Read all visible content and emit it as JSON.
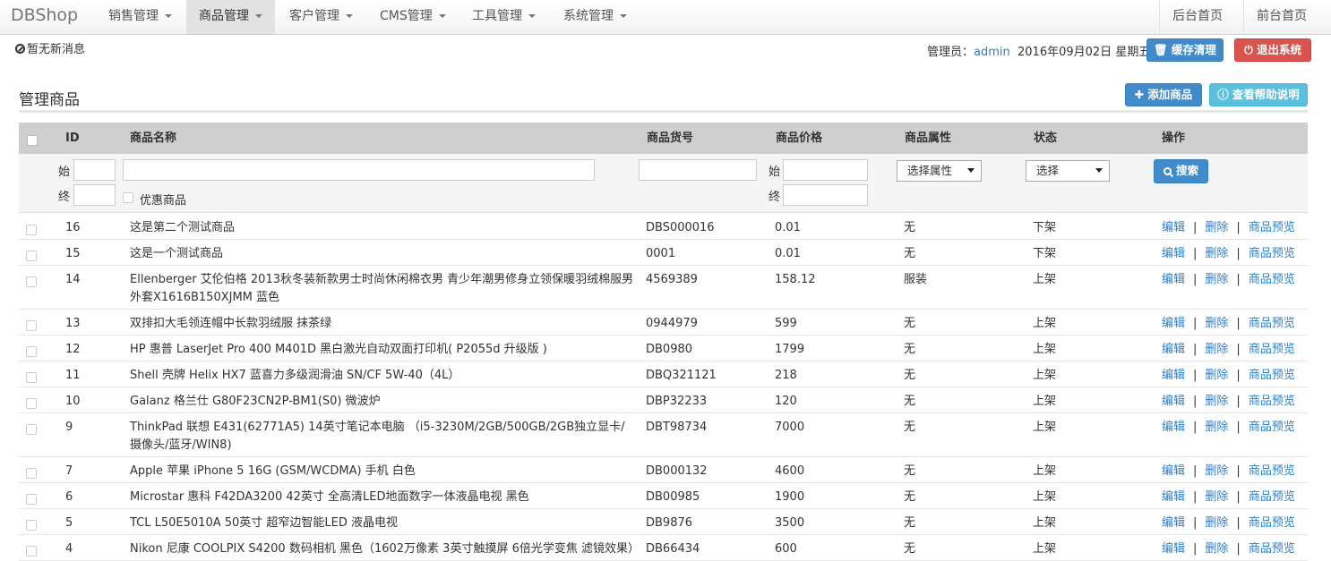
{
  "navbar": {
    "brand": "DBShop",
    "menus": [
      {
        "label": "销售管理",
        "active": false
      },
      {
        "label": "商品管理",
        "active": true
      },
      {
        "label": "客户管理",
        "active": false
      },
      {
        "label": "CMS管理",
        "active": false
      },
      {
        "label": "工具管理",
        "active": false
      },
      {
        "label": "系统管理",
        "active": false
      }
    ],
    "right_links": [
      "后台首页",
      "前台首页"
    ]
  },
  "status": {
    "notice": "暂无新消息",
    "admin_label": "管理员：",
    "admin_name": "admin",
    "date": "2016年09月02日 星期五",
    "clear_cache_label": "缓存清理",
    "logout_label": "退出系统"
  },
  "page": {
    "title": "管理商品",
    "add_label": "添加商品",
    "help_label": "查看帮助说明"
  },
  "table": {
    "headers": {
      "id": "ID",
      "name": "商品名称",
      "sku": "商品货号",
      "price": "商品价格",
      "attr": "商品属性",
      "status": "状态",
      "ops": "操作"
    },
    "filter": {
      "start_label": "始",
      "end_label": "终",
      "discount_label": "优惠商品",
      "attr_select": "选择属性",
      "status_select": "选择",
      "search_label": "搜索"
    },
    "op_labels": {
      "edit": "编辑",
      "delete": "删除",
      "preview": "商品预览",
      "sep": "|"
    },
    "rows": [
      {
        "id": "16",
        "name": "这是第二个测试商品",
        "sku": "DBS000016",
        "price": "0.01",
        "attr": "无",
        "status": "下架"
      },
      {
        "id": "15",
        "name": "这是一个测试商品",
        "sku": "0001",
        "price": "0.01",
        "attr": "无",
        "status": "下架"
      },
      {
        "id": "14",
        "name": "Ellenberger 艾伦伯格 2013秋冬装新款男士时尚休闲棉衣男 青少年潮男修身立领保暖羽绒棉服男外套X1616B150XJMM 蓝色",
        "sku": "4569389",
        "price": "158.12",
        "attr": "服装",
        "status": "上架"
      },
      {
        "id": "13",
        "name": "双排扣大毛领连帽中长款羽绒服 抹茶绿",
        "sku": "0944979",
        "price": "599",
        "attr": "无",
        "status": "上架"
      },
      {
        "id": "12",
        "name": "HP 惠普 LaserJet Pro 400 M401D 黑白激光自动双面打印机( P2055d 升级版 )",
        "sku": "DB0980",
        "price": "1799",
        "attr": "无",
        "status": "上架"
      },
      {
        "id": "11",
        "name": "Shell 壳牌 Helix HX7 蓝喜力多级润滑油 SN/CF 5W-40（4L）",
        "sku": "DBQ321121",
        "price": "218",
        "attr": "无",
        "status": "上架"
      },
      {
        "id": "10",
        "name": "Galanz 格兰仕 G80F23CN2P-BM1(S0) 微波炉",
        "sku": "DBP32233",
        "price": "120",
        "attr": "无",
        "status": "上架"
      },
      {
        "id": "9",
        "name": "ThinkPad 联想 E431(62771A5) 14英寸笔记本电脑 （i5-3230M/2GB/500GB/2GB独立显卡/摄像头/蓝牙/WIN8)",
        "sku": "DBT98734",
        "price": "7000",
        "attr": "无",
        "status": "上架"
      },
      {
        "id": "7",
        "name": "Apple 苹果 iPhone 5 16G (GSM/WCDMA) 手机 白色",
        "sku": "DB000132",
        "price": "4600",
        "attr": "无",
        "status": "上架"
      },
      {
        "id": "6",
        "name": "Microstar 惠科 F42DA3200 42英寸 全高清LED地面数字一体液晶电视 黑色",
        "sku": "DB00985",
        "price": "1900",
        "attr": "无",
        "status": "上架"
      },
      {
        "id": "5",
        "name": "TCL L50E5010A 50英寸 超窄边智能LED 液晶电视",
        "sku": "DB9876",
        "price": "3500",
        "attr": "无",
        "status": "上架"
      },
      {
        "id": "4",
        "name": "Nikon 尼康 COOLPIX S4200 数码相机 黑色（1602万像素 3英寸触摸屏 6倍光学变焦 滤镜效果）",
        "sku": "DB66434",
        "price": "600",
        "attr": "无",
        "status": "上架"
      }
    ]
  }
}
